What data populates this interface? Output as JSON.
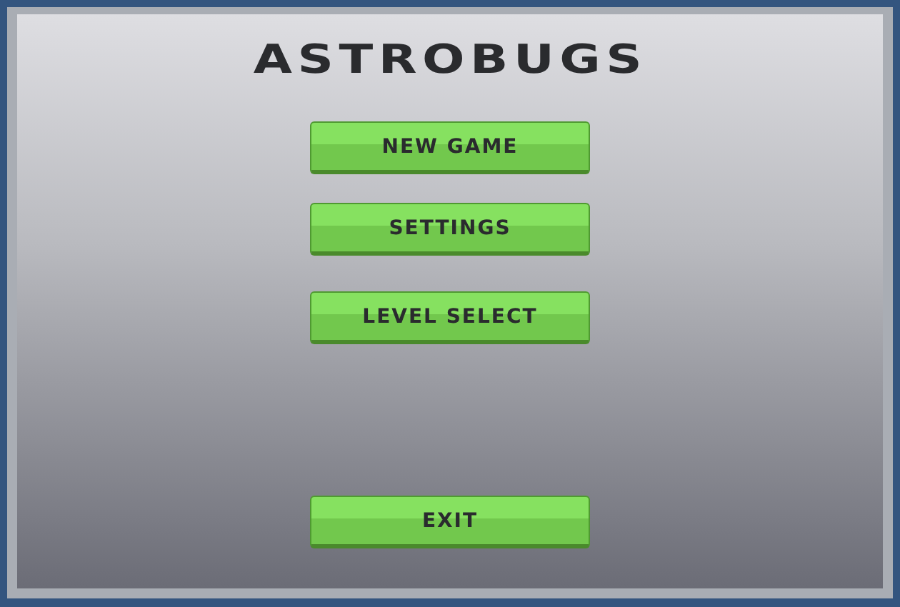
{
  "title": "ASTROBUGS",
  "menu": [
    {
      "label": "NEW GAME",
      "kind": "main"
    },
    {
      "label": "SETTINGS",
      "kind": "main"
    },
    {
      "label": "LEVEL SELECT",
      "kind": "main"
    },
    {
      "label": "EXIT",
      "kind": "bottom"
    }
  ]
}
